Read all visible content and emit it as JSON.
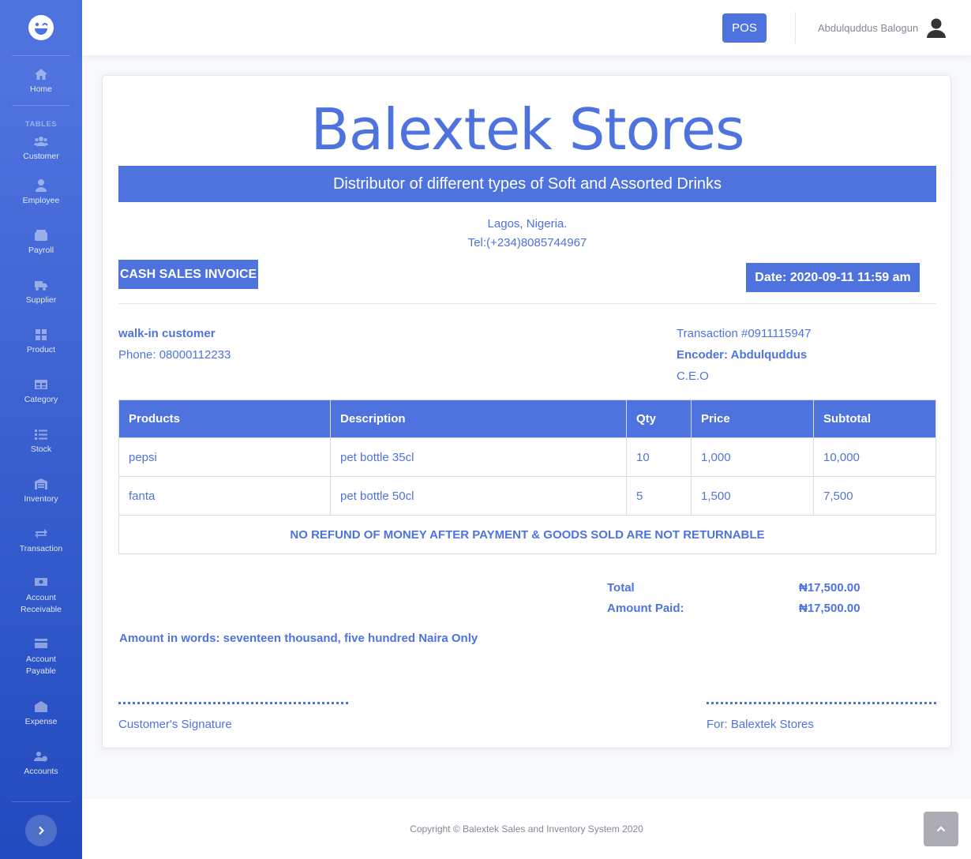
{
  "sidebar": {
    "heading": "TABLES",
    "items": [
      {
        "label": "Home",
        "icon": "home-icon"
      },
      {
        "label": "Customer",
        "icon": "users-icon"
      },
      {
        "label": "Employee",
        "icon": "user-icon"
      },
      {
        "label": "Payroll",
        "icon": "wallet-icon"
      },
      {
        "label": "Supplier",
        "icon": "truck-icon"
      },
      {
        "label": "Product",
        "icon": "grid-icon"
      },
      {
        "label": "Category",
        "icon": "table-icon"
      },
      {
        "label": "Stock",
        "icon": "list-icon"
      },
      {
        "label": "Inventory",
        "icon": "warehouse-icon"
      },
      {
        "label": "Transaction",
        "icon": "exchange-icon"
      },
      {
        "label": "Account Receivable",
        "icon": "money-icon"
      },
      {
        "label": "Account Payable",
        "icon": "credit-card-icon"
      },
      {
        "label": "Expense",
        "icon": "envelope-icon"
      },
      {
        "label": "Accounts",
        "icon": "users-cog-icon"
      }
    ]
  },
  "topbar": {
    "pos_label": "POS",
    "user_name": "Abdulquddus Balogun"
  },
  "invoice": {
    "store_name": "Balextek Stores",
    "tagline": "Distributor of different types of Soft and Assorted Drinks",
    "address": "Lagos, Nigeria.",
    "tel": "Tel:(+234)8085744967",
    "invoice_type": "CASH SALES INVOICE",
    "date": "Date: 2020-09-11 11:59 am",
    "customer_name": "walk-in customer",
    "customer_phone": "Phone: 08000112233",
    "transaction": "Transaction #0911115947",
    "encoder": "Encoder: Abdulquddus",
    "encoder_role": "C.E.O",
    "columns": [
      "Products",
      "Description",
      "Qty",
      "Price",
      "Subtotal"
    ],
    "rows": [
      [
        "pepsi",
        "pet bottle 35cl",
        "10",
        "1,000",
        "10,000"
      ],
      [
        "fanta",
        "pet bottle 50cl",
        "5",
        "1,500",
        "7,500"
      ]
    ],
    "notice": "NO REFUND OF MONEY AFTER PAYMENT & GOODS SOLD ARE NOT RETURNABLE",
    "total_label": "Total",
    "total_value": "₦17,500.00",
    "paid_label": "Amount Paid:",
    "paid_value": "₦17,500.00",
    "amount_words": "Amount in words: seventeen thousand, five hundred Naira Only",
    "customer_signature": "Customer's Signature",
    "for_label": "For: Balextek Stores"
  },
  "footer": {
    "copyright": "Copyright © Balextek Sales and Inventory System 2020"
  },
  "colors": {
    "primary": "#4e73df",
    "sidebar_dark": "#224abe"
  }
}
